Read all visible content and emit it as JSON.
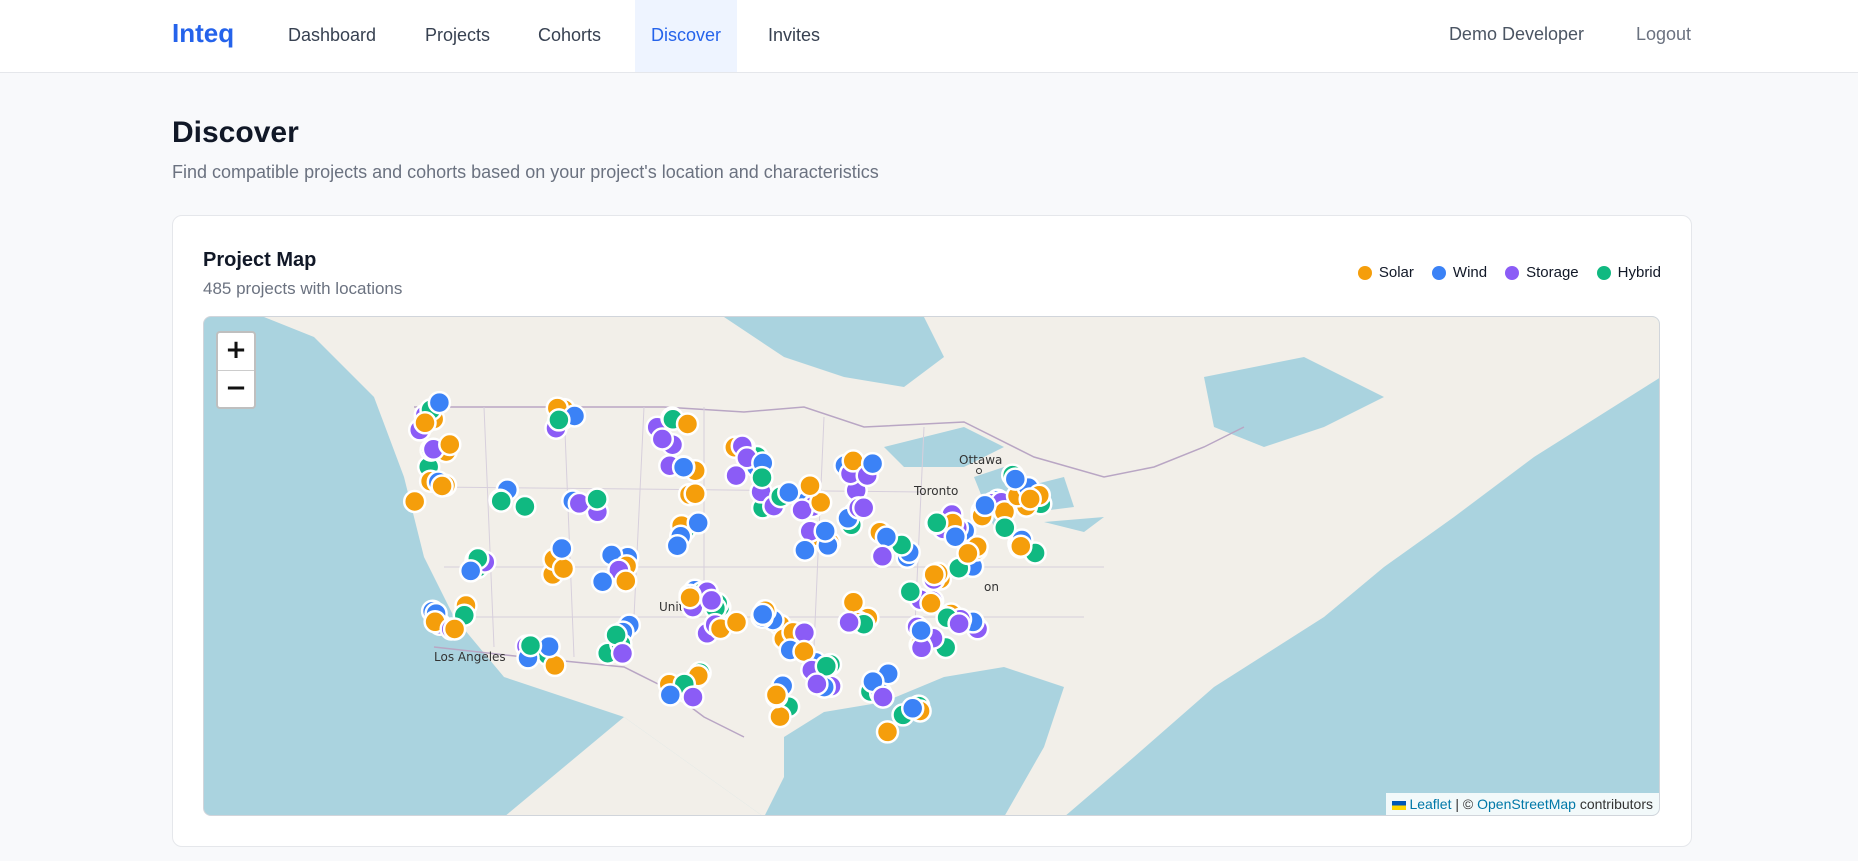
{
  "nav": {
    "brand": "Inteq",
    "links": [
      {
        "label": "Dashboard"
      },
      {
        "label": "Projects"
      },
      {
        "label": "Cohorts"
      },
      {
        "label": "Discover"
      },
      {
        "label": "Invites"
      }
    ],
    "active": "Discover",
    "user_name": "Demo Developer",
    "logout_label": "Logout"
  },
  "page": {
    "title": "Discover",
    "subtitle": "Find compatible projects and cohorts based on your project's location and characteristics"
  },
  "map_card": {
    "title": "Project Map",
    "count_text": "485 projects with locations",
    "legend": [
      {
        "label": "Solar",
        "color": "#f59e0b"
      },
      {
        "label": "Wind",
        "color": "#3b82f6"
      },
      {
        "label": "Storage",
        "color": "#8b5cf6"
      },
      {
        "label": "Hybrid",
        "color": "#10b981"
      }
    ],
    "zoom_in_label": "+",
    "zoom_out_label": "−",
    "attribution": {
      "leaflet": "Leaflet",
      "separator": " | © ",
      "osm": "OpenStreetMap",
      "suffix": " contributors"
    },
    "place_labels": [
      "Ottawa",
      "Toronto",
      "Los Angeles",
      "Unite",
      "on"
    ]
  }
}
